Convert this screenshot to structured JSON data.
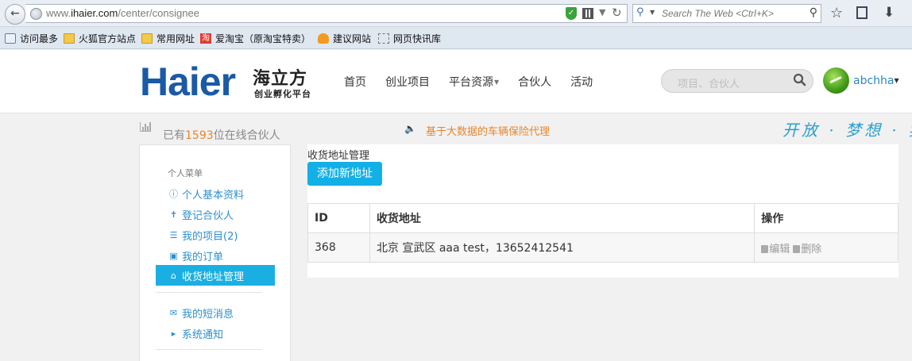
{
  "browser": {
    "url_prefix": "www.",
    "url_domain": "ihaier.com",
    "url_path": "/center/consignee",
    "search_placeholder": "Search The Web <Ctrl+K>"
  },
  "bookmarks": [
    {
      "label": "访问最多",
      "icon": "visit-icon"
    },
    {
      "label": "火狐官方站点",
      "icon": "folder-icon"
    },
    {
      "label": "常用网址",
      "icon": "folder-icon"
    },
    {
      "label": "爱淘宝（原淘宝特卖）",
      "icon": "taobao-icon"
    },
    {
      "label": "建议网站",
      "icon": "bulb-icon"
    },
    {
      "label": "网页快讯库",
      "icon": "webslice-icon"
    }
  ],
  "site": {
    "logo_text": "Haier",
    "logo_cn": "海立方",
    "logo_sub": "创业孵化平台",
    "nav": [
      "首页",
      "创业项目",
      "平台资源",
      "合伙人",
      "活动"
    ],
    "search_placeholder": "项目、合伙人",
    "user_name": "abchha",
    "brand_color": "#1a5aa6",
    "accent_color": "#1aafe3"
  },
  "info": {
    "online_prefix": "已有",
    "online_count": "1593",
    "online_suffix": "位在线合伙人",
    "notice": "基于大数据的车辆保险代理",
    "slogan": "开放 · 梦想 · 实"
  },
  "sidebar": {
    "heading": "个人菜单",
    "items": [
      {
        "label": "个人基本资料",
        "icon": "info-icon"
      },
      {
        "label": "登记合伙人",
        "icon": "person-icon"
      },
      {
        "label": "我的项目(2)",
        "icon": "list-icon"
      },
      {
        "label": "我的订单",
        "icon": "cart-icon"
      },
      {
        "label": "收货地址管理",
        "icon": "home-icon"
      },
      {
        "label": "我的短消息",
        "icon": "envelope-icon"
      },
      {
        "label": "系统通知",
        "icon": "bullhorn-icon"
      }
    ]
  },
  "main": {
    "title": "收货地址管理",
    "add_button": "添加新地址",
    "columns": [
      "ID",
      "收货地址",
      "操作"
    ],
    "rows": [
      {
        "id": "368",
        "address": "北京 宣武区 aaa  test，13652412541",
        "edit": "编辑",
        "delete": "删除"
      }
    ]
  }
}
